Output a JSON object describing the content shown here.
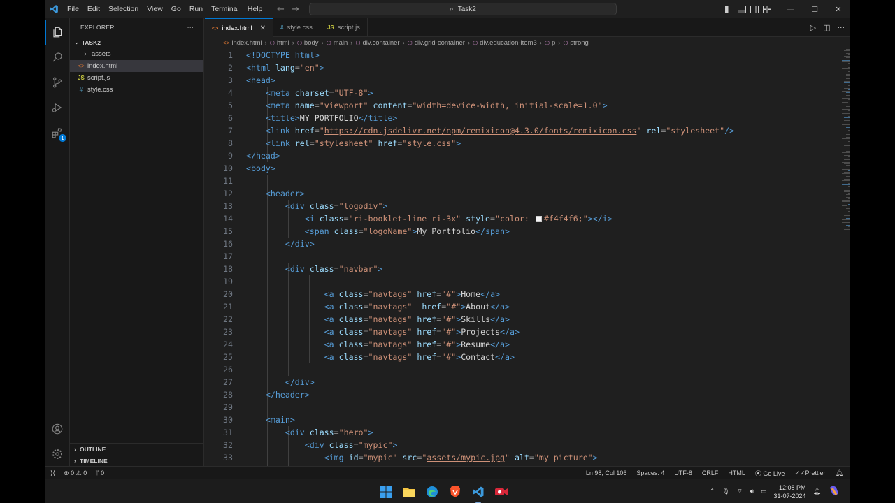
{
  "menu": [
    "File",
    "Edit",
    "Selection",
    "View",
    "Go",
    "Run",
    "Terminal",
    "Help"
  ],
  "command_center": "Task2",
  "explorer": {
    "title": "EXPLORER",
    "more": "···",
    "folder": "TASK2",
    "items": [
      {
        "label": "assets",
        "icon": "›",
        "type": "folder"
      },
      {
        "label": "index.html",
        "icon": "<>",
        "type": "html"
      },
      {
        "label": "script.js",
        "icon": "JS",
        "type": "js"
      },
      {
        "label": "style.css",
        "icon": "#",
        "type": "css"
      }
    ],
    "outline": "OUTLINE",
    "timeline": "TIMELINE"
  },
  "tabs": [
    {
      "label": "index.html",
      "icon": "<>",
      "active": true
    },
    {
      "label": "style.css",
      "icon": "#",
      "active": false
    },
    {
      "label": "script.js",
      "icon": "JS",
      "active": false
    }
  ],
  "breadcrumbs": [
    "index.html",
    "html",
    "body",
    "main",
    "div.container",
    "div.grid-container",
    "div.education-item3",
    "p",
    "strong"
  ],
  "code_lines": [
    "1",
    "2",
    "3",
    "4",
    "5",
    "6",
    "7",
    "8",
    "9",
    "10",
    "11",
    "12",
    "13",
    "14",
    "15",
    "16",
    "17",
    "18",
    "19",
    "20",
    "21",
    "22",
    "23",
    "24",
    "25",
    "26",
    "27",
    "28",
    "29",
    "30",
    "31",
    "32",
    "33"
  ],
  "code": {
    "l1": "<!DOCTYPE html>",
    "l2a": "<html",
    "l2b": " lang",
    "l2c": "=",
    "l2d": "\"en\"",
    "l2e": ">",
    "l3": "<head>",
    "l4a": "<meta",
    "l4b": " charset",
    "l4d": "\"UTF-8\"",
    "l4e": ">",
    "l5a": "<meta",
    "l5b": " name",
    "l5d": "\"viewport\"",
    "l5f": " content",
    "l5g": "\"width=device-width, initial-scale=1.0\"",
    "l5e": ">",
    "l6a": "<title>",
    "l6b": "MY PORTFOLIO",
    "l6c": "</title>",
    "l7a": "<link",
    "l7b": " href",
    "l7q": "\"",
    "l7u": "https://cdn.jsdelivr.net/npm/remixicon@4.3.0/fonts/remixicon.css",
    "l7q2": "\"",
    "l7f": " rel",
    "l7g": "\"stylesheet\"",
    "l7e": "/>",
    "l8a": "<link",
    "l8b": " rel",
    "l8d": "\"stylesheet\"",
    "l8f": " href",
    "l8q": "\"",
    "l8u": "style.css",
    "l8q2": "\"",
    "l8e": ">",
    "l9": "</head>",
    "l10": "<body>",
    "l12": "<header>",
    "l13a": "<div",
    "l13b": " class",
    "l13d": "\"logodiv\"",
    "l13e": ">",
    "l14a": "<i",
    "l14b": " class",
    "l14d": "\"ri-booklet-line ri-3x\"",
    "l14f": " style",
    "l14g1": "\"color: ",
    "l14g2": "#f4f4f6;\"",
    "l14e": "></i>",
    "l15a": "<span",
    "l15b": " class",
    "l15d": "\"logoName\"",
    "l15e": ">",
    "l15t": "My Portfolio",
    "l15c": "</span>",
    "l16": "</div>",
    "l18a": "<div",
    "l18b": " class",
    "l18d": "\"navbar\"",
    "l18e": ">",
    "nav": [
      {
        "cls_sep": " class",
        "cls": "\"navtags\"",
        "href_sep": " href",
        "href": "\"#\"",
        "text": "Home"
      },
      {
        "cls_sep": " class",
        "cls": "\"navtags\"",
        "href_sep": "  href",
        "href": "\"#\"",
        "text": "About"
      },
      {
        "cls_sep": " class",
        "cls": "\"navtags\"",
        "href_sep": " href",
        "href": "\"#\"",
        "text": "Skills"
      },
      {
        "cls_sep": " class",
        "cls": "\"navtags\"",
        "href_sep": " href",
        "href": "\"#\"",
        "text": "Projects"
      },
      {
        "cls_sep": " class",
        "cls": "\"navtags\"",
        "href_sep": " href",
        "href": "\"#\"",
        "text": "Resume"
      },
      {
        "cls_sep": " class",
        "cls": "\"navtags\"",
        "href_sep": " href",
        "href": "\"#\"",
        "text": "Contact"
      }
    ],
    "l27": "</div>",
    "l28": "</header>",
    "l30": "<main>",
    "l31a": "<div",
    "l31b": " class",
    "l31d": "\"hero\"",
    "l31e": ">",
    "l32a": "<div",
    "l32b": " class",
    "l32d": "\"mypic\"",
    "l32e": ">",
    "l33a": "<img",
    "l33b": " id",
    "l33d": "\"mypic\"",
    "l33f": " src",
    "l33q": "\"",
    "l33u": "assets/mypic.jpg",
    "l33q2": "\"",
    "l33h": " alt",
    "l33g": "\"my_picture\"",
    "l33e": ">"
  },
  "status": {
    "errors": "0",
    "warnings": "0",
    "ports": "0",
    "position": "Ln 98, Col 106",
    "spaces": "Spaces: 4",
    "encoding": "UTF-8",
    "eol": "CRLF",
    "language": "HTML",
    "golive": "Go Live",
    "prettier": "Prettier"
  },
  "taskbar": {
    "time": "12:08 PM",
    "date": "31-07-2024"
  },
  "colors": {
    "accent": "#0078d4",
    "tag": "#569cd6",
    "attr": "#9cdcfe",
    "string": "#ce9178",
    "swatch": "#f4f4f6"
  }
}
